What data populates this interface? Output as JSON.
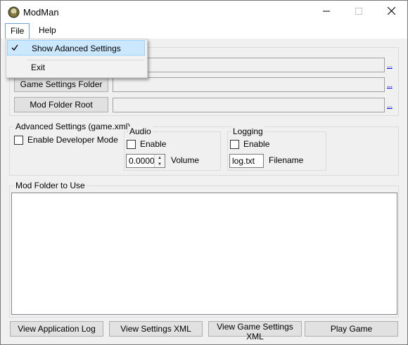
{
  "window": {
    "title": "ModMan",
    "app_icon": "game-logo-icon"
  },
  "menu": {
    "file": "File",
    "help": "Help"
  },
  "file_menu": {
    "show_advanced": "Show Adanced Settings",
    "show_advanced_checked": true,
    "exit": "Exit"
  },
  "paths": {
    "game_settings_button": "Game Settings Folder",
    "mod_root_button": "Mod Folder Root",
    "browse": "..."
  },
  "advanced": {
    "title": "Advanced Settings (game.xml)",
    "developer_mode": "Enable Developer Mode",
    "audio": {
      "title": "Audio",
      "enable": "Enable",
      "volume_value": "0.0000",
      "volume_label": "Volume"
    },
    "logging": {
      "title": "Logging",
      "enable": "Enable",
      "filename_value": "log.txt",
      "filename_label": "Filename"
    }
  },
  "mod_folder": {
    "title": "Mod Folder to Use",
    "items": []
  },
  "buttons": {
    "view_app_log": "View Application Log",
    "view_settings_xml": "View Settings XML",
    "view_game_settings_xml": "View Game Settings XML",
    "play_game": "Play Game"
  }
}
